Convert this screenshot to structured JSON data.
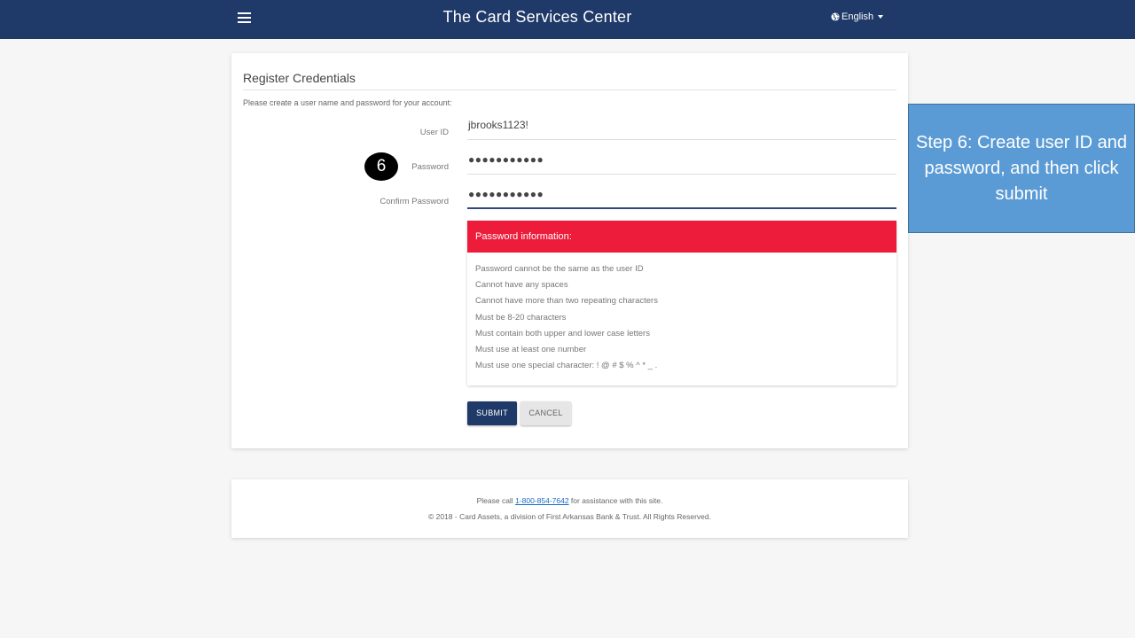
{
  "header": {
    "title": "The Card Services Center",
    "language": "English",
    "menu_icon": "hamburger-menu-icon",
    "language_icon": "globe-icon"
  },
  "form": {
    "title": "Register Credentials",
    "subtitle": "Please create a user name and password for your account:",
    "fields": [
      {
        "label": "User ID",
        "value": "jbrooks1123!"
      },
      {
        "label": "Password",
        "value": "●●●●●●●●●●●"
      },
      {
        "label": "Confirm Password",
        "value": "●●●●●●●●●●●"
      }
    ],
    "step_badge": "6",
    "info": {
      "heading": "Password information:",
      "rules": [
        "Password cannot be the same as the user ID",
        "Cannot have any spaces",
        "Cannot have more than two repeating characters",
        "Must be 8-20 characters",
        "Must contain both upper and lower case letters",
        "Must use at least one number",
        "Must use one special character: ! @ # $ % ^ * _ ."
      ]
    },
    "submit_label": "SUBMIT",
    "cancel_label": "CANCEL"
  },
  "footer": {
    "call_prefix": "Please call ",
    "phone": "1-800-854-7642",
    "call_suffix": " for assistance with this site.",
    "copyright": "© 2018 - Card Assets, a division of First Arkansas Bank & Trust. All Rights Reserved."
  },
  "callout": {
    "text": "Step 6: Create user ID and password, and then click submit"
  },
  "colors": {
    "header_bg": "#1f3a68",
    "alert_red": "#ec1c3a",
    "callout_blue": "#5b9bd5"
  }
}
